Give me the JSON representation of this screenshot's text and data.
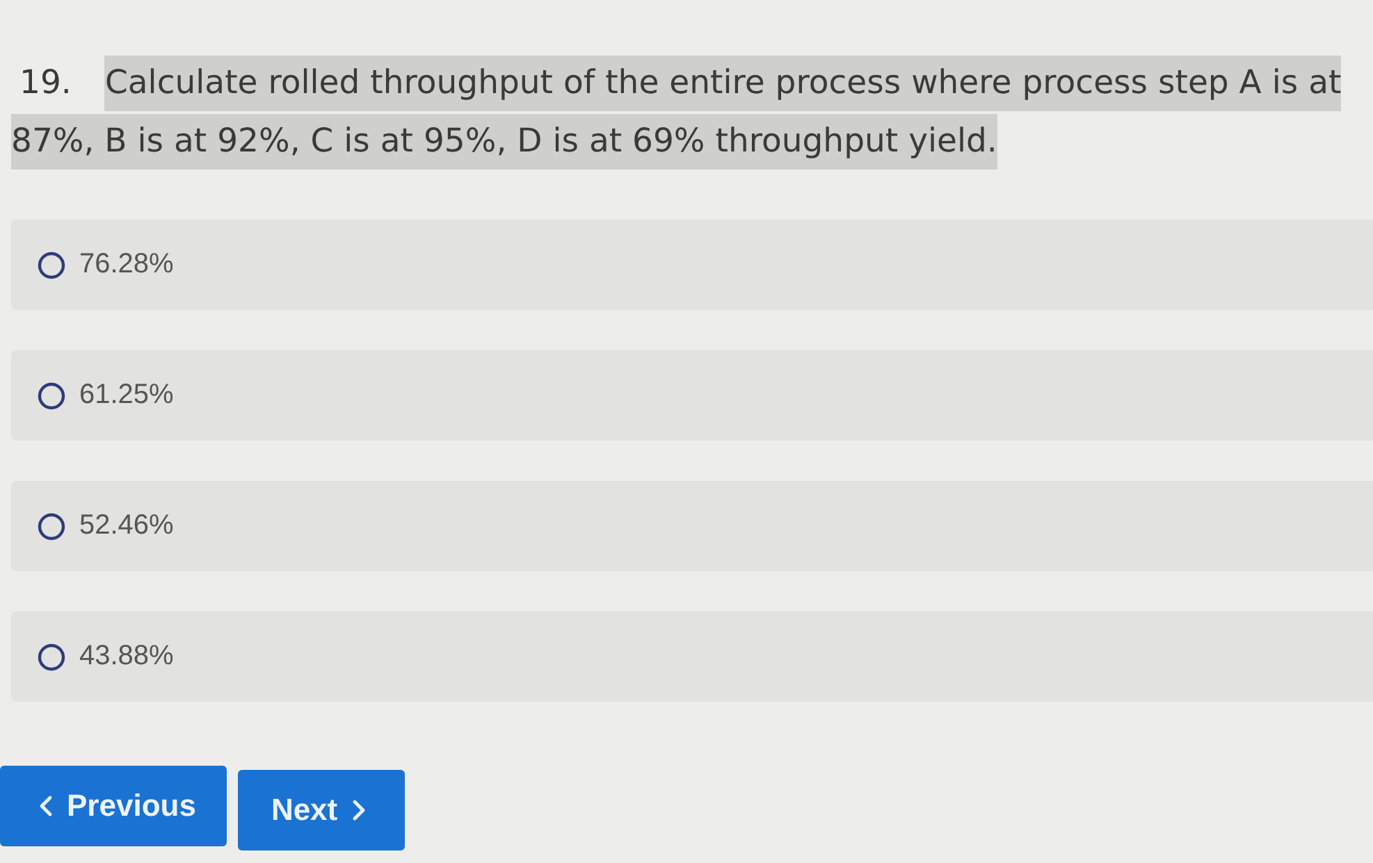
{
  "question": {
    "number": "19.",
    "text": "Calculate rolled throughput of the entire process where process step A is at 87%, B is at 92%, C is at 95%, D is at 69% throughput yield.",
    "highlighted": true
  },
  "options": [
    {
      "label": "76.28%",
      "selected": false
    },
    {
      "label": "61.25%",
      "selected": false
    },
    {
      "label": "52.46%",
      "selected": false
    },
    {
      "label": "43.88%",
      "selected": false
    }
  ],
  "navigation": [
    {
      "kind": "previous",
      "label": "Previous"
    },
    {
      "kind": "next",
      "label": "Next"
    }
  ]
}
